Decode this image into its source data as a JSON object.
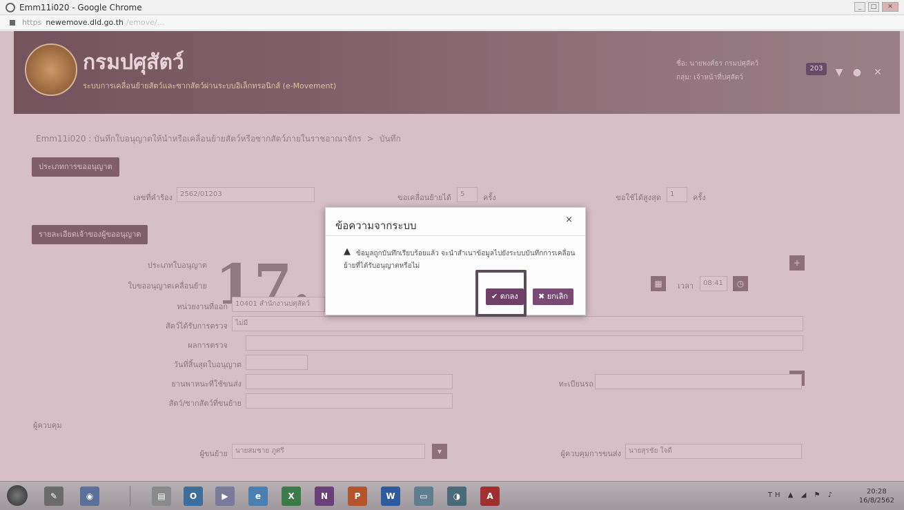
{
  "browser": {
    "window_title": "Emm11i020 - Google Chrome",
    "url_scheme": "https",
    "url_host": "newemove.dld.go.th",
    "url_path": "/emove/..."
  },
  "header": {
    "site_title": "กรมปศุสัตว์",
    "site_subtitle": "ระบบการเคลื่อนย้ายสัตว์และซากสัตว์ผ่านระบบอิเล็กทรอนิกส์ (e-Movement)",
    "user_line_1": "ชื่อ: นายพงศ์ธร กรมปศุสัตว์",
    "user_line_2": "กลุ่ม: เจ้าหน้าที่ปศุสัตว์",
    "notification_count": "203"
  },
  "breadcrumb": {
    "page_id_title": "Emm11i020 : บันทึกใบอนุญาตให้นำหรือเคลื่อนย้ายสัตว์หรือซากสัตว์ภายในราชอาณาจักร",
    "separator": ">",
    "current": "บันทึก"
  },
  "form": {
    "section1_button": "ประเภทการขออนุญาต",
    "row1_label": "เลขที่คำร้อง",
    "row1_value": "2562/01203",
    "row1_mid_label": "ขอเคลื่อนย้ายได้",
    "row1_mid_value": "5",
    "row1_mid_unit": "ครั้ง",
    "row1_right_label": "ขอใช้ได้สูงสุด",
    "row1_right_value": "1",
    "row1_right_unit": "ครั้ง",
    "section2_button": "รายละเอียดเจ้าของผู้ขออนุญาต",
    "big_number": "17.",
    "row2_label": "ประเภทใบอนุญาต",
    "row3_label": "ใบขออนุญาตเคลื่อนย้าย",
    "row4_label": "หน่วยงานที่ออก",
    "row4_value": "10401 สำนักงานปศุสัตว์",
    "row5_label": "สัตว์ได้รับการตรวจ",
    "row5_value": "ไม่มี",
    "row6_label": "ผลการตรวจ",
    "row7_label": "วันที่สิ้นสุดใบอนุญาต",
    "row8_label": "ยานพาหนะที่ใช้ขนส่ง",
    "row8_right_label": "ทะเบียนรถ",
    "row9_label": "สัตว์/ซากสัตว์ที่ขนย้าย",
    "row10_label": "ผู้ขนย้าย",
    "row10_value": "นายสมชาย ภูศรี",
    "row10_right_label": "ผู้ควบคุมการขนส่ง",
    "row10_right_value": "นายสุรชัย ใจดี",
    "section_people": "ผู้ควบคุม",
    "time_value": "08:41"
  },
  "dialog": {
    "title": "ข้อความจากระบบ",
    "close_glyph": "×",
    "warning_glyph": "▲",
    "message": "ข้อมูลถูกบันทึกเรียบร้อยแล้ว จะนำสำเนาข้อมูลไปยังระบบบันทึกการเคลื่อนย้ายที่ได้รับอนุญาตหรือไม่",
    "ok_label": "✔ ตกลง",
    "cancel_label": "✖ ยกเลิก"
  },
  "taskbar": {
    "clock_time": "20:28",
    "clock_date": "16/8/2562",
    "input_lang": "TH"
  }
}
